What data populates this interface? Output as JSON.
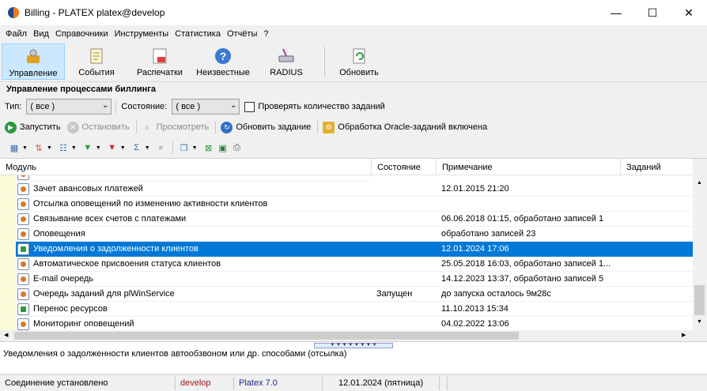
{
  "window": {
    "title": "Billing - PLATEX platex@develop",
    "min": "—",
    "max": "☐",
    "close": "✕"
  },
  "menu": [
    "Файл",
    "Вид",
    "Справочники",
    "Инструменты",
    "Статистика",
    "Отчёты",
    "?"
  ],
  "toolbar": {
    "items": [
      "Управление",
      "События",
      "Распечатки",
      "Неизвестные",
      "RADIUS",
      "Обновить"
    ]
  },
  "section_title": "Управление процессами биллинга",
  "filters": {
    "type_label": "Тип:",
    "type_value": "( все )",
    "state_label": "Состояние:",
    "state_value": "( все )",
    "check_label": "Проверять количество заданий"
  },
  "actions": {
    "start": "Запустить",
    "stop": "Остановить",
    "view": "Просмотреть",
    "refresh_task": "Обновить задание",
    "oracle": "Обработка Oracle-заданий включена"
  },
  "grid": {
    "columns": [
      "Модуль",
      "Состояние",
      "Примечание",
      "Заданий"
    ],
    "rows": [
      {
        "module": "Зачет авансовых платежей",
        "state": "",
        "note": "12.01.2015 21:20",
        "count": "",
        "icon": "gear"
      },
      {
        "module": "Отсылка оповещений по изменению активности клиентов",
        "state": "",
        "note": "",
        "count": "",
        "icon": "gear"
      },
      {
        "module": "Связывание всех счетов с платежами",
        "state": "",
        "note": "06.06.2018 01:15, обработано записей 1",
        "count": "",
        "icon": "gear"
      },
      {
        "module": "Оповещения",
        "state": "",
        "note": "обработано записей 23",
        "count": "",
        "icon": "gear"
      },
      {
        "module": "Уведомления о задолженности клиентов",
        "state": "",
        "note": "12.01.2024 17:06",
        "count": "",
        "icon": "list",
        "selected": true
      },
      {
        "module": "Автоматическое присвоения статуса клиентов",
        "state": "",
        "note": "25.05.2018 16:03, обработано записей 1...",
        "count": "",
        "icon": "gear"
      },
      {
        "module": "E-mail очередь",
        "state": "",
        "note": "14.12.2023 13:37, обработано записей 5",
        "count": "",
        "icon": "gear"
      },
      {
        "module": "Очередь заданий для plWinService",
        "state": "Запущен",
        "note": "до запуска осталось 9м28с",
        "count": "",
        "icon": "gear"
      },
      {
        "module": "Перенос ресурсов",
        "state": "",
        "note": "11.10.2013 15:34",
        "count": "",
        "icon": "list-green"
      },
      {
        "module": "Мониторинг оповещений",
        "state": "",
        "note": "04.02.2022 13:06",
        "count": "",
        "icon": "gear"
      }
    ]
  },
  "description": "Уведомления о задолженности клиентов автообзвоном или др. способами (отсылка)",
  "status": {
    "connection": "Соединение установлено",
    "db": "develop",
    "version": "Platex 7.0",
    "date": "12.01.2024 (пятница)"
  },
  "colors": {
    "accent": "#0078d7",
    "db_text": "#a01818",
    "version_text": "#1a2a8a",
    "indent_bg": "#fcfbd9"
  }
}
